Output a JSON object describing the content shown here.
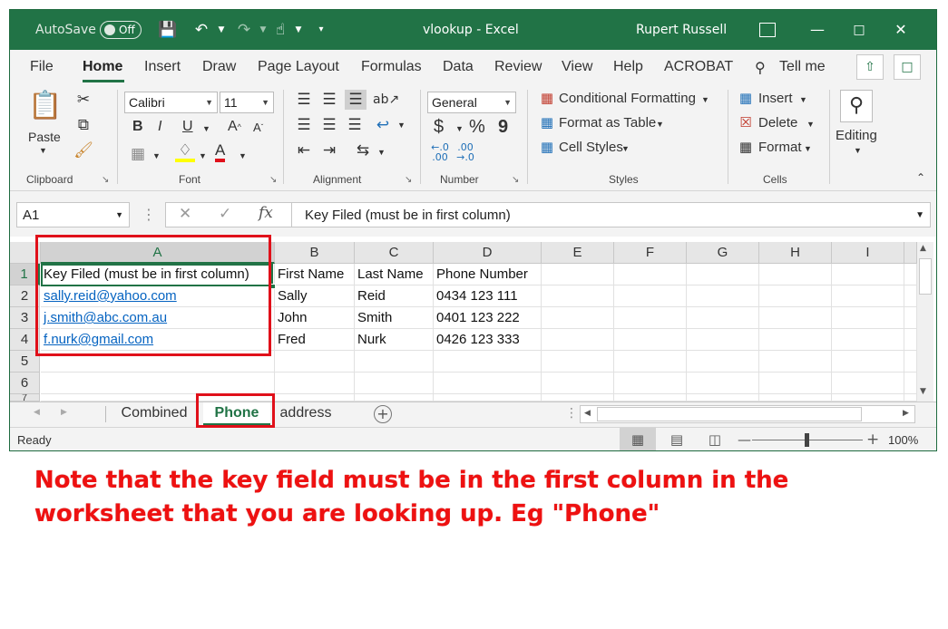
{
  "titlebar": {
    "autosave_label": "AutoSave",
    "autosave_state": "Off",
    "title": "vlookup  -  Excel",
    "user": "Rupert Russell"
  },
  "ribbon_tabs": [
    "File",
    "Home",
    "Insert",
    "Draw",
    "Page Layout",
    "Formulas",
    "Data",
    "Review",
    "View",
    "Help",
    "ACROBAT",
    "Tell me"
  ],
  "active_tab": "Home",
  "ribbon": {
    "clipboard": {
      "paste_label": "Paste",
      "group_label": "Clipboard"
    },
    "font": {
      "font_name": "Calibri",
      "font_size": "11",
      "bold": "B",
      "italic": "I",
      "underline": "U",
      "grow": "A",
      "shrink": "A",
      "font_color": "A",
      "group_label": "Font"
    },
    "alignment": {
      "group_label": "Alignment"
    },
    "number": {
      "format": "General",
      "currency": "$",
      "percent": "%",
      "comma": "9",
      "group_label": "Number"
    },
    "styles": {
      "conditional": "Conditional Formatting",
      "format_table": "Format as Table",
      "cell_styles": "Cell Styles",
      "group_label": "Styles"
    },
    "cells": {
      "insert": "Insert",
      "delete": "Delete",
      "format": "Format",
      "group_label": "Cells"
    },
    "editing": {
      "label": "Editing"
    }
  },
  "formula_bar": {
    "name_box": "A1",
    "formula": "Key Filed (must be in first column)"
  },
  "grid": {
    "columns": [
      "A",
      "B",
      "C",
      "D",
      "E",
      "F",
      "G",
      "H",
      "I"
    ],
    "rows": [
      "1",
      "2",
      "3",
      "4",
      "5",
      "6",
      "7"
    ],
    "cells": [
      [
        "Key Filed (must be in first column)",
        "First Name",
        "Last Name",
        "Phone Number"
      ],
      [
        "sally.reid@yahoo.com",
        "Sally",
        "Reid",
        "0434 123 111"
      ],
      [
        "j.smith@abc.com.au",
        "John",
        "Smith",
        "0401 123 222"
      ],
      [
        "f.nurk@gmail.com",
        "Fred",
        "Nurk",
        "0426 123 333"
      ]
    ]
  },
  "sheets": [
    "Combined",
    "Phone",
    "address"
  ],
  "active_sheet": "Phone",
  "status": {
    "ready": "Ready",
    "zoom": "100%"
  },
  "note": "Note that the key field must be in the first column in the worksheet that you are looking up.  Eg \"Phone\"",
  "colors": {
    "excel_green": "#217346",
    "annotation_red": "#e0101a",
    "link_blue": "#0563c1"
  }
}
